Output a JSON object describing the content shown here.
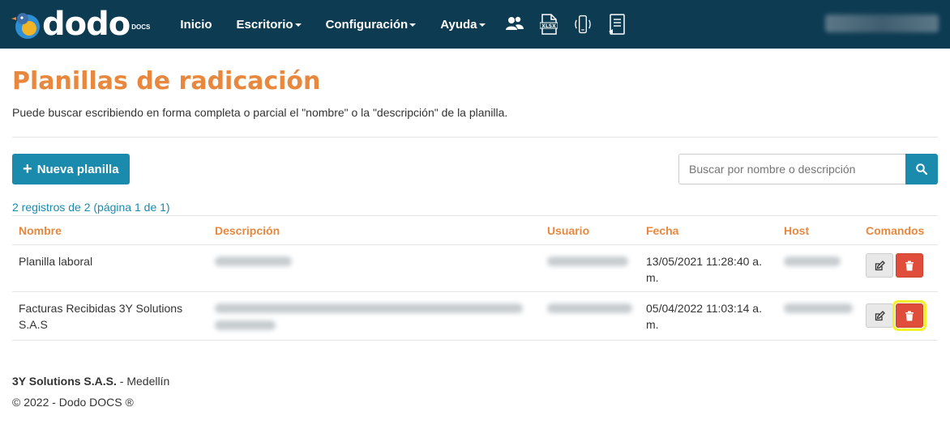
{
  "brand": {
    "name": "dodo",
    "sub": "DOCS"
  },
  "nav": {
    "inicio": "Inicio",
    "escritorio": "Escritorio",
    "configuracion": "Configuración",
    "ayuda": "Ayuda",
    "icons": [
      "users-icon",
      "xlsx-file-icon",
      "mobile-icon",
      "document-list-icon"
    ]
  },
  "page": {
    "title": "Planillas de radicación",
    "description": "Puede buscar escribiendo en forma completa o parcial el \"nombre\" o la \"descripción\" de la planilla."
  },
  "toolbar": {
    "new_label": "Nueva planilla",
    "search_placeholder": "Buscar por nombre o descripción"
  },
  "records_info": "2 registros de 2 (página 1 de 1)",
  "table": {
    "headers": [
      "Nombre",
      "Descripción",
      "Usuario",
      "Fecha",
      "Host",
      "Comandos"
    ],
    "rows": [
      {
        "nombre": "Planilla laboral",
        "fecha": "13/05/2021 11:28:40 a. m."
      },
      {
        "nombre": "Facturas Recibidas 3Y Solutions S.A.S",
        "fecha": "05/04/2022 11:03:14 a. m."
      }
    ]
  },
  "footer": {
    "company": "3Y Solutions S.A.S.",
    "city": " - Medellín",
    "copyright": "© 2022 - Dodo DOCS ®"
  },
  "colors": {
    "navbar": "#0d3b52",
    "accent": "#e8883e",
    "primary": "#1a8aad",
    "danger": "#e04d3b"
  }
}
